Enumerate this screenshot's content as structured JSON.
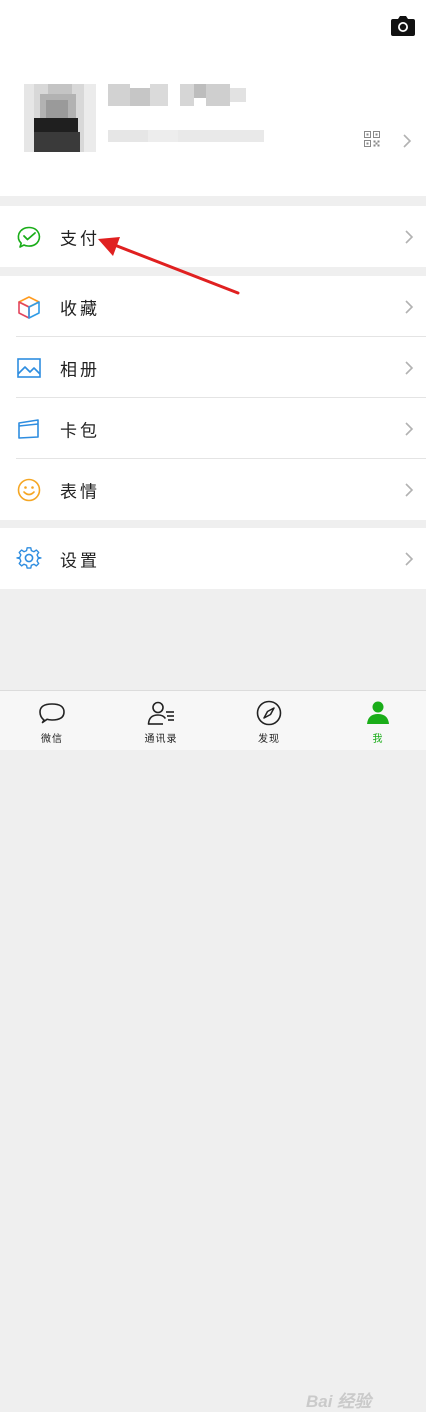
{
  "colors": {
    "accent_green": "#1aad19",
    "arrow_red": "#e02020",
    "page_bg": "#efefef"
  },
  "header": {
    "camera_icon": "camera-icon"
  },
  "profile": {
    "qr_icon": "qr-code-icon"
  },
  "groups": [
    {
      "items": [
        {
          "label": "支付",
          "icon": "wallet-pay-icon"
        }
      ]
    },
    {
      "items": [
        {
          "label": "收藏",
          "icon": "cube-favorites-icon"
        },
        {
          "label": "相册",
          "icon": "picture-album-icon"
        },
        {
          "label": "卡包",
          "icon": "card-wallet-icon"
        },
        {
          "label": "表情",
          "icon": "smiley-emoji-icon"
        }
      ]
    },
    {
      "items": [
        {
          "label": "设置",
          "icon": "gear-icon"
        }
      ]
    }
  ],
  "tabbar": {
    "tabs": [
      {
        "label": "微信",
        "icon": "chat-bubble-icon",
        "active": false
      },
      {
        "label": "通讯录",
        "icon": "contacts-icon",
        "active": false
      },
      {
        "label": "发现",
        "icon": "compass-icon",
        "active": false
      },
      {
        "label": "我",
        "icon": "person-icon",
        "active": true
      }
    ]
  },
  "watermark": {
    "text": "Bai 经验"
  }
}
